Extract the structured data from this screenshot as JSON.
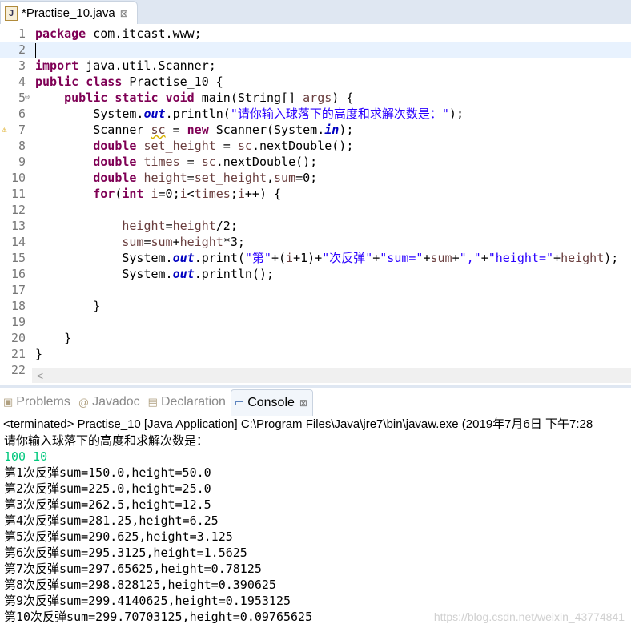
{
  "editor_tab": {
    "title": "*Practise_10.java",
    "icon": "java-file-icon",
    "close": "⊠"
  },
  "code_lines": [
    [
      [
        "k",
        "package"
      ],
      [
        "p",
        " com.itcast.www;"
      ]
    ],
    [],
    [
      [
        "k",
        "import"
      ],
      [
        "p",
        " java.util.Scanner;"
      ]
    ],
    [
      [
        "k",
        "public"
      ],
      [
        "p",
        " "
      ],
      [
        "k",
        "class"
      ],
      [
        "p",
        " Practise_10 {"
      ]
    ],
    [
      [
        "p",
        "    "
      ],
      [
        "k",
        "public"
      ],
      [
        "p",
        " "
      ],
      [
        "k",
        "static"
      ],
      [
        "p",
        " "
      ],
      [
        "k",
        "void"
      ],
      [
        "p",
        " main(String[] "
      ],
      [
        "v",
        "args"
      ],
      [
        "p",
        ") {"
      ]
    ],
    [
      [
        "p",
        "        System."
      ],
      [
        "f",
        "out"
      ],
      [
        "p",
        ".println("
      ],
      [
        "s",
        "\"请你输入球落下的高度和求解次数是：\""
      ],
      [
        "p",
        ");"
      ]
    ],
    [
      [
        "p",
        "        Scanner "
      ],
      [
        "v",
        "sc",
        "sq"
      ],
      [
        "p",
        " = "
      ],
      [
        "k",
        "new"
      ],
      [
        "p",
        " Scanner(System."
      ],
      [
        "f",
        "in"
      ],
      [
        "p",
        ");"
      ]
    ],
    [
      [
        "p",
        "        "
      ],
      [
        "k",
        "double"
      ],
      [
        "p",
        " "
      ],
      [
        "v",
        "set_height"
      ],
      [
        "p",
        " = "
      ],
      [
        "v",
        "sc"
      ],
      [
        "p",
        ".nextDouble();"
      ]
    ],
    [
      [
        "p",
        "        "
      ],
      [
        "k",
        "double"
      ],
      [
        "p",
        " "
      ],
      [
        "v",
        "times"
      ],
      [
        "p",
        " = "
      ],
      [
        "v",
        "sc"
      ],
      [
        "p",
        ".nextDouble();"
      ]
    ],
    [
      [
        "p",
        "        "
      ],
      [
        "k",
        "double"
      ],
      [
        "p",
        " "
      ],
      [
        "v",
        "height"
      ],
      [
        "p",
        "="
      ],
      [
        "v",
        "set_height"
      ],
      [
        "p",
        ","
      ],
      [
        "v",
        "sum"
      ],
      [
        "p",
        "=0;"
      ]
    ],
    [
      [
        "p",
        "        "
      ],
      [
        "k",
        "for"
      ],
      [
        "p",
        "("
      ],
      [
        "k",
        "int"
      ],
      [
        "p",
        " "
      ],
      [
        "v",
        "i"
      ],
      [
        "p",
        "=0;"
      ],
      [
        "v",
        "i"
      ],
      [
        "p",
        "<"
      ],
      [
        "v",
        "times"
      ],
      [
        "p",
        ";"
      ],
      [
        "v",
        "i"
      ],
      [
        "p",
        "++) {"
      ]
    ],
    [],
    [
      [
        "p",
        "            "
      ],
      [
        "v",
        "height"
      ],
      [
        "p",
        "="
      ],
      [
        "v",
        "height"
      ],
      [
        "p",
        "/2;"
      ]
    ],
    [
      [
        "p",
        "            "
      ],
      [
        "v",
        "sum"
      ],
      [
        "p",
        "="
      ],
      [
        "v",
        "sum"
      ],
      [
        "p",
        "+"
      ],
      [
        "v",
        "height"
      ],
      [
        "p",
        "*3;"
      ]
    ],
    [
      [
        "p",
        "            System."
      ],
      [
        "f",
        "out"
      ],
      [
        "p",
        ".print("
      ],
      [
        "s",
        "\"第\""
      ],
      [
        "p",
        "+("
      ],
      [
        "v",
        "i"
      ],
      [
        "p",
        "+1)+"
      ],
      [
        "s",
        "\"次反弹\""
      ],
      [
        "p",
        "+"
      ],
      [
        "s",
        "\"sum=\""
      ],
      [
        "p",
        "+"
      ],
      [
        "v",
        "sum"
      ],
      [
        "p",
        "+"
      ],
      [
        "s",
        "\",\""
      ],
      [
        "p",
        "+"
      ],
      [
        "s",
        "\"height=\""
      ],
      [
        "p",
        "+"
      ],
      [
        "v",
        "height"
      ],
      [
        "p",
        ");"
      ]
    ],
    [
      [
        "p",
        "            System."
      ],
      [
        "f",
        "out"
      ],
      [
        "p",
        ".println();"
      ]
    ],
    [],
    [
      [
        "p",
        "        }"
      ]
    ],
    [],
    [
      [
        "p",
        "    }"
      ]
    ],
    [
      [
        "p",
        "}"
      ]
    ],
    []
  ],
  "current_line": 2,
  "bottom_tabs": [
    {
      "label": "Problems",
      "icon": "problems-icon",
      "active": false
    },
    {
      "label": "Javadoc",
      "icon": "at-icon",
      "active": false
    },
    {
      "label": "Declaration",
      "icon": "declaration-icon",
      "active": false
    },
    {
      "label": "Console",
      "icon": "console-icon",
      "active": true
    }
  ],
  "console": {
    "header": "<terminated> Practise_10 [Java Application] C:\\Program Files\\Java\\jre7\\bin\\javaw.exe (2019年7月6日 下午7:28",
    "prompt": "请你输入球落下的高度和求解次数是：",
    "input": "100 10",
    "output": [
      "第1次反弹sum=150.0,height=50.0",
      "第2次反弹sum=225.0,height=25.0",
      "第3次反弹sum=262.5,height=12.5",
      "第4次反弹sum=281.25,height=6.25",
      "第5次反弹sum=290.625,height=3.125",
      "第6次反弹sum=295.3125,height=1.5625",
      "第7次反弹sum=297.65625,height=0.78125",
      "第8次反弹sum=298.828125,height=0.390625",
      "第9次反弹sum=299.4140625,height=0.1953125",
      "第10次反弹sum=299.70703125,height=0.09765625"
    ]
  },
  "watermark": "https://blog.csdn.net/weixin_43774841"
}
